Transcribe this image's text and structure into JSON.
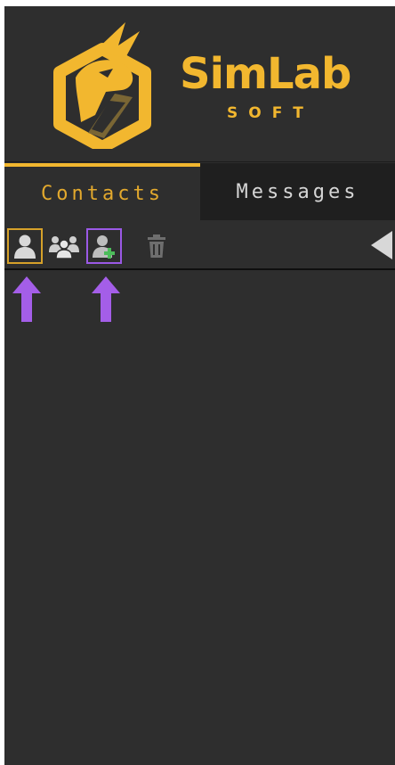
{
  "brand": {
    "name": "SimLab",
    "sub": "SOFT",
    "color": "#f2b72f"
  },
  "tabs": [
    {
      "label": "Contacts",
      "active": true
    },
    {
      "label": "Messages",
      "active": false
    }
  ],
  "toolbar": {
    "buttons": [
      {
        "icon": "user-icon",
        "state": "selected"
      },
      {
        "icon": "group-icon",
        "state": "normal"
      },
      {
        "icon": "add-user-icon",
        "state": "highlighted"
      },
      {
        "icon": "trash-icon",
        "state": "disabled"
      }
    ],
    "collapse_icon": "triangle-left-icon"
  },
  "annotations": {
    "arrow_color": "#a45ee8",
    "arrows": [
      "arrow-up-icon",
      "arrow-up-icon"
    ]
  }
}
